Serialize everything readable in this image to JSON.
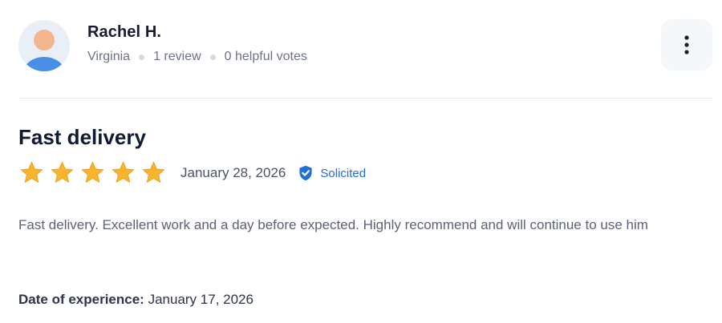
{
  "reviewer": {
    "name": "Rachel H.",
    "location": "Virginia",
    "review_count": "1 review",
    "helpful_votes": "0 helpful votes",
    "avatar_icon": "user-avatar-icon"
  },
  "menu": {
    "icon": "more-vertical-icon"
  },
  "review": {
    "title": "Fast delivery",
    "rating": 5,
    "rating_max": 5,
    "date": "January 28, 2026",
    "badge_label": "Solicited",
    "badge_icon": "shield-check-icon",
    "body": "Fast delivery. Excellent work and a day before expected. Highly recommend and will continue to use him",
    "experience_label": "Date of experience:",
    "experience_date": "January 17, 2026"
  },
  "colors": {
    "star": "#f7b42c",
    "badge": "#1f6fd8",
    "divider": "#e6e9ee"
  }
}
